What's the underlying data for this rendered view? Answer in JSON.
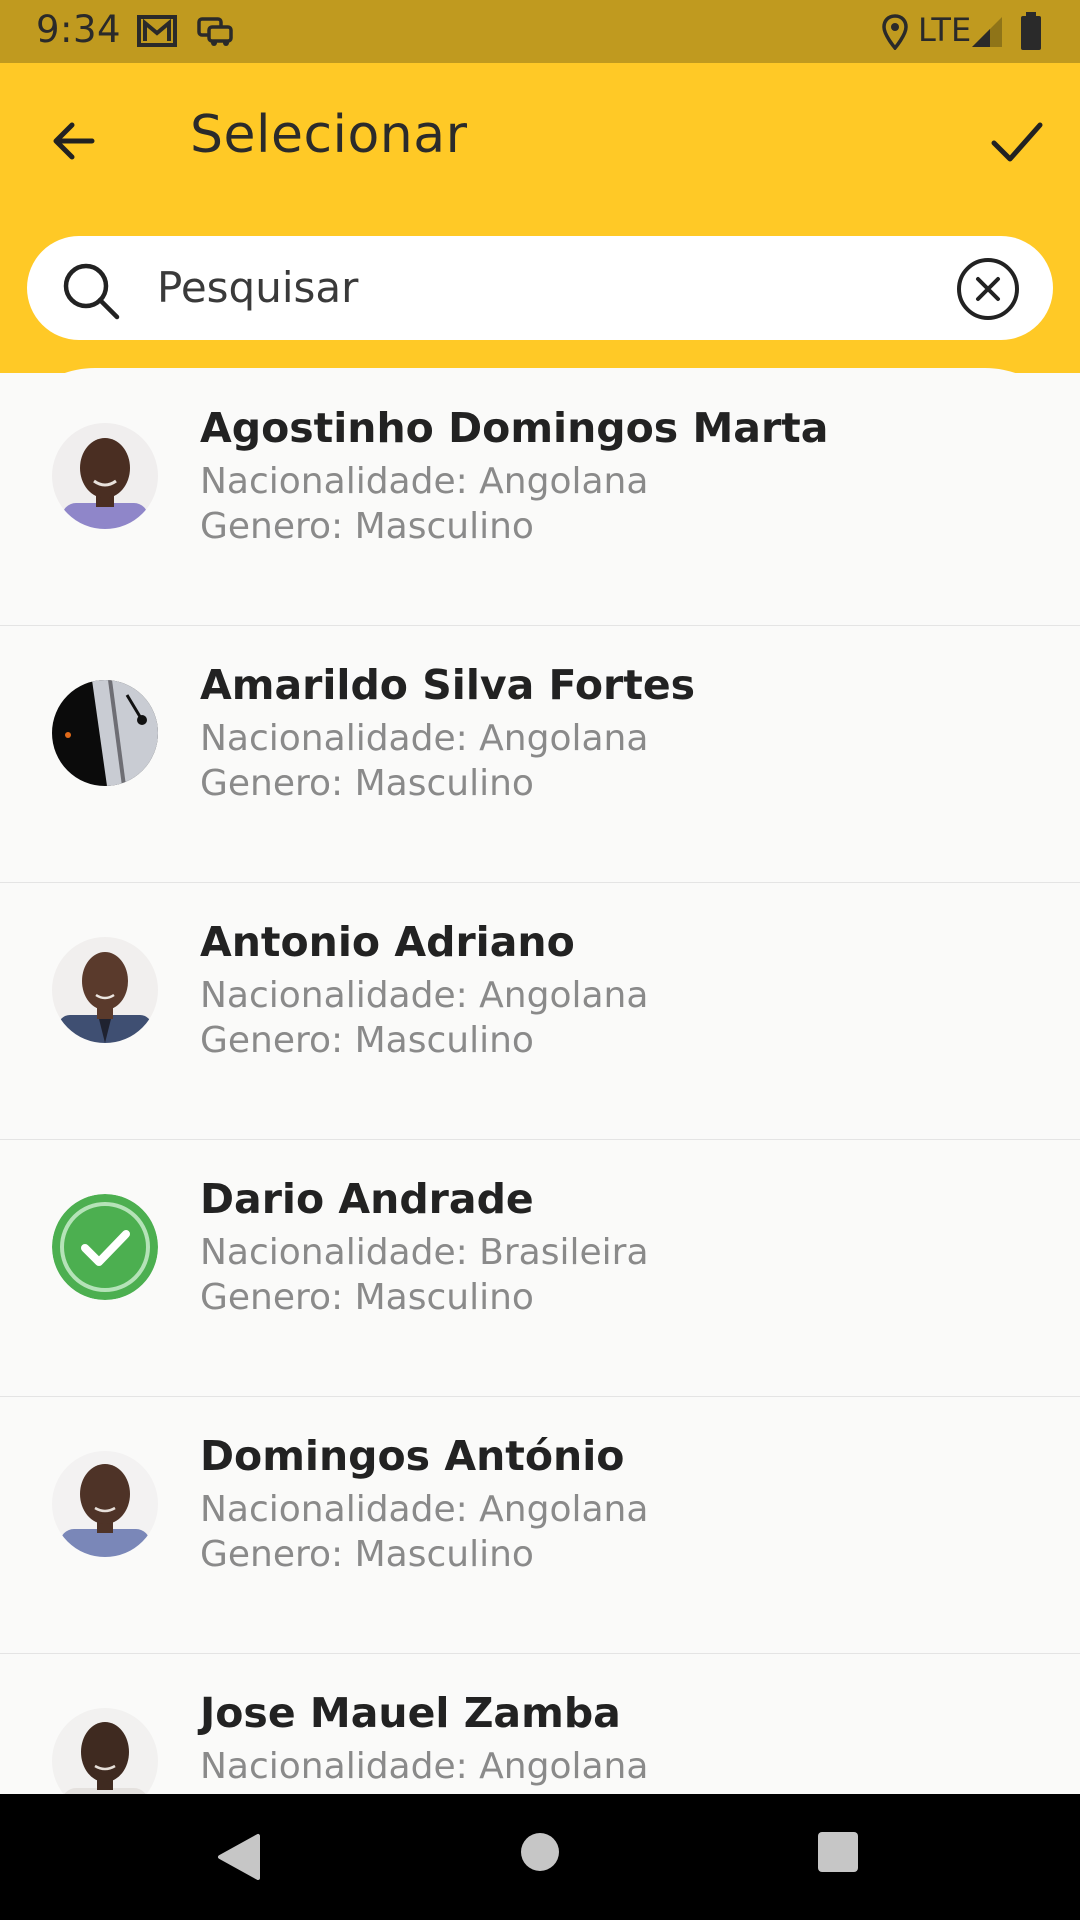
{
  "status_bar": {
    "time": "9:34",
    "network": "LTE",
    "icons": [
      "gmail-icon",
      "car-icon",
      "location-icon",
      "signal-icon",
      "battery-icon"
    ]
  },
  "header": {
    "title": "Selecionar",
    "back_icon": "arrow-left-icon",
    "confirm_icon": "check-icon"
  },
  "search": {
    "placeholder": "Pesquisar",
    "value": ""
  },
  "people": [
    {
      "name": "Agostinho Domingos Marta",
      "nationality": "Nacionalidade: Angolana",
      "gender": "Genero: Masculino",
      "selected": false
    },
    {
      "name": "Amarildo Silva Fortes",
      "nationality": "Nacionalidade: Angolana",
      "gender": "Genero: Masculino",
      "selected": false
    },
    {
      "name": "Antonio Adriano",
      "nationality": "Nacionalidade: Angolana",
      "gender": "Genero: Masculino",
      "selected": false
    },
    {
      "name": "Dario Andrade",
      "nationality": "Nacionalidade: Brasileira",
      "gender": "Genero: Masculino",
      "selected": true
    },
    {
      "name": "Domingos António",
      "nationality": "Nacionalidade: Angolana",
      "gender": "Genero: Masculino",
      "selected": false
    },
    {
      "name": "Jose Mauel Zamba",
      "nationality": "Nacionalidade: Angolana",
      "gender": "",
      "selected": false
    }
  ],
  "colors": {
    "status_bar": "#c09a1f",
    "accent": "#ffc926",
    "selected": "#4caf50"
  }
}
